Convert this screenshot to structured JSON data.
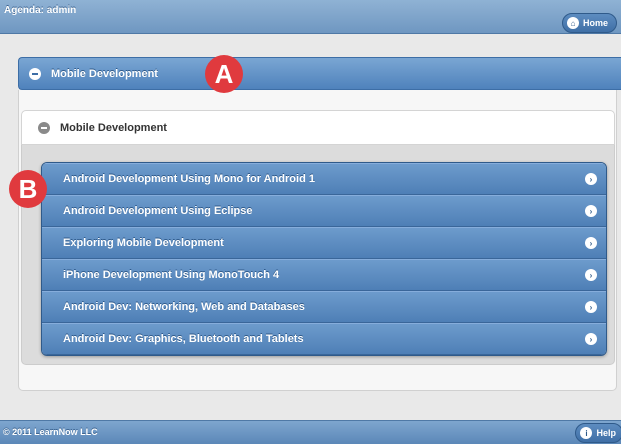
{
  "header": {
    "title": "Agenda: admin",
    "home_label": "Home"
  },
  "section": {
    "title": "Mobile Development"
  },
  "subsection": {
    "title": "Mobile Development"
  },
  "courses": [
    {
      "label": "Android Development Using Mono for Android 1"
    },
    {
      "label": "Android Development Using Eclipse"
    },
    {
      "label": "Exploring Mobile Development"
    },
    {
      "label": "iPhone Development Using MonoTouch 4"
    },
    {
      "label": "Android Dev: Networking, Web and Databases"
    },
    {
      "label": "Android Dev: Graphics, Bluetooth and Tablets"
    }
  ],
  "footer": {
    "copyright": "© 2011 LearnNow LLC",
    "help_label": "Help"
  },
  "callouts": {
    "a": "A",
    "b": "B"
  },
  "icons": {
    "home": "home-icon",
    "collapse": "minus-icon",
    "item_arrow": "chevron-right-icon",
    "help": "info-icon"
  },
  "colors": {
    "accent": "#5b87b8",
    "badge": "#e03a3e"
  }
}
